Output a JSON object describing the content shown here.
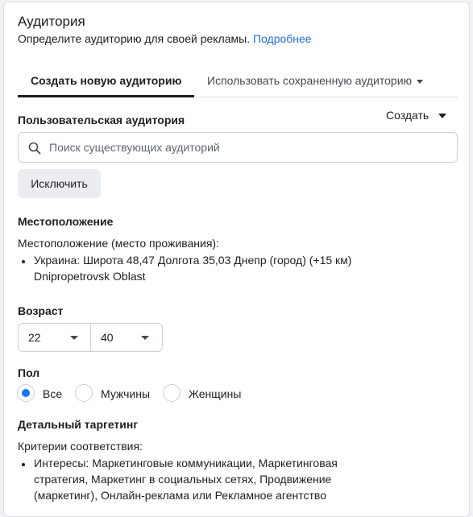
{
  "header": {
    "title": "Аудитория",
    "subtitle": "Определите аудиторию для своей рекламы.",
    "more_link": "Подробнее"
  },
  "tabs": [
    {
      "label": "Создать новую аудиторию",
      "active": true
    },
    {
      "label": "Использовать сохраненную аудиторию",
      "active": false
    }
  ],
  "custom_audience": {
    "label": "Пользовательская аудитория",
    "create_label": "Создать",
    "search_placeholder": "Поиск существующих аудиторий",
    "exclude_label": "Исключить"
  },
  "location": {
    "heading": "Местоположение",
    "type_label": "Местоположение (место проживания):",
    "item_line1": "Украина: Широта 48,47 Долгота 35,03 Днепр (город) (+15 км)",
    "item_line2": "Dnipropetrovsk Oblast"
  },
  "age": {
    "heading": "Возраст",
    "min": "22",
    "max": "40"
  },
  "gender": {
    "heading": "Пол",
    "options": [
      {
        "label": "Все",
        "selected": true
      },
      {
        "label": "Мужчины",
        "selected": false
      },
      {
        "label": "Женщины",
        "selected": false
      }
    ]
  },
  "detailed_targeting": {
    "heading": "Детальный таргетинг",
    "criteria_label": "Критерии соответствия:",
    "interests_line1": "Интересы: Маркетинговые коммуникации, Маркетинговая",
    "interests_line2": "стратегия, Маркетинг в социальных сетях, Продвижение",
    "interests_line3": "(маркетинг), Онлайн-реклама или Рекламное агентство"
  },
  "colors": {
    "link": "#216fdb",
    "radio_selected": "#1877f2",
    "border": "#ccd0d5"
  }
}
